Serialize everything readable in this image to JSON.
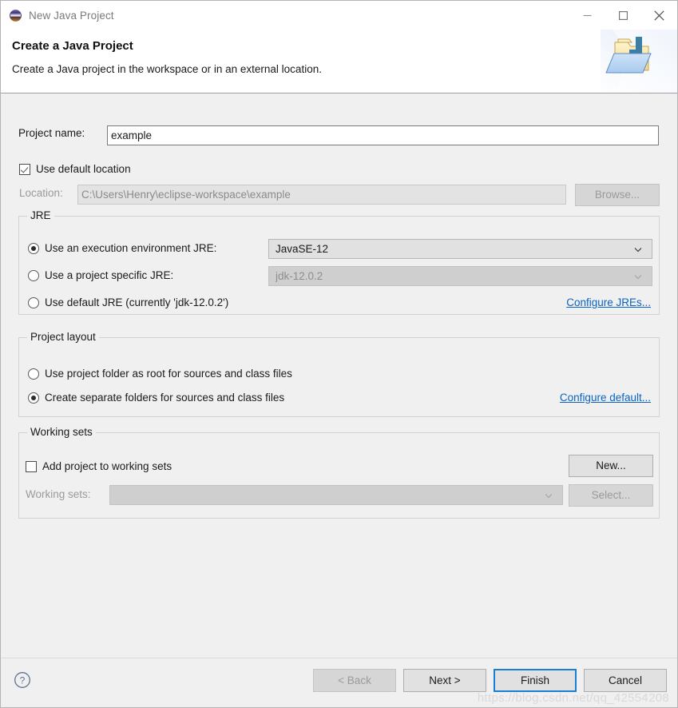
{
  "window": {
    "title": "New Java Project",
    "icon": "eclipse-icon",
    "controls": {
      "minimize": "minimize-icon",
      "maximize": "maximize-icon",
      "close": "close-icon"
    }
  },
  "banner": {
    "title": "Create a Java Project",
    "description": "Create a Java project in the workspace or in an external location.",
    "art": "java-project-folder-icon"
  },
  "project": {
    "name_label": "Project name:",
    "name_value": "example",
    "name_placeholder": "",
    "use_default_location_label": "Use default location",
    "use_default_location_checked": true,
    "location_label": "Location:",
    "location_value": "C:\\Users\\Henry\\eclipse-workspace\\example",
    "browse_label": "Browse...",
    "browse_enabled": false
  },
  "jre": {
    "group_title": "JRE",
    "options": [
      {
        "label": "Use an execution environment JRE:",
        "selected": true
      },
      {
        "label": "Use a project specific JRE:",
        "selected": false
      },
      {
        "label": "Use default JRE (currently 'jdk-12.0.2')",
        "selected": false
      }
    ],
    "execution_env_value": "JavaSE-12",
    "execution_env_enabled": true,
    "project_jre_value": "jdk-12.0.2",
    "project_jre_enabled": false,
    "configure_link": "Configure JREs..."
  },
  "layout": {
    "group_title": "Project layout",
    "options": [
      {
        "label": "Use project folder as root for sources and class files",
        "selected": false
      },
      {
        "label": "Create separate folders for sources and class files",
        "selected": true
      }
    ],
    "configure_link": "Configure default..."
  },
  "working_sets": {
    "group_title": "Working sets",
    "add_label": "Add project to working sets",
    "add_checked": false,
    "new_label": "New...",
    "new_enabled": true,
    "sets_label": "Working sets:",
    "sets_value": "",
    "sets_enabled": false,
    "select_label": "Select...",
    "select_enabled": false
  },
  "footer": {
    "help": "help-icon",
    "back_label": "< Back",
    "back_enabled": false,
    "next_label": "Next >",
    "next_enabled": true,
    "finish_label": "Finish",
    "finish_default": true,
    "cancel_label": "Cancel"
  },
  "watermark": "https://blog.csdn.net/qq_42554208",
  "colors": {
    "accent": "#1a7fd4",
    "link": "#0a63c2",
    "body_bg": "#f0f0f0",
    "banner_bg": "#ffffff"
  }
}
